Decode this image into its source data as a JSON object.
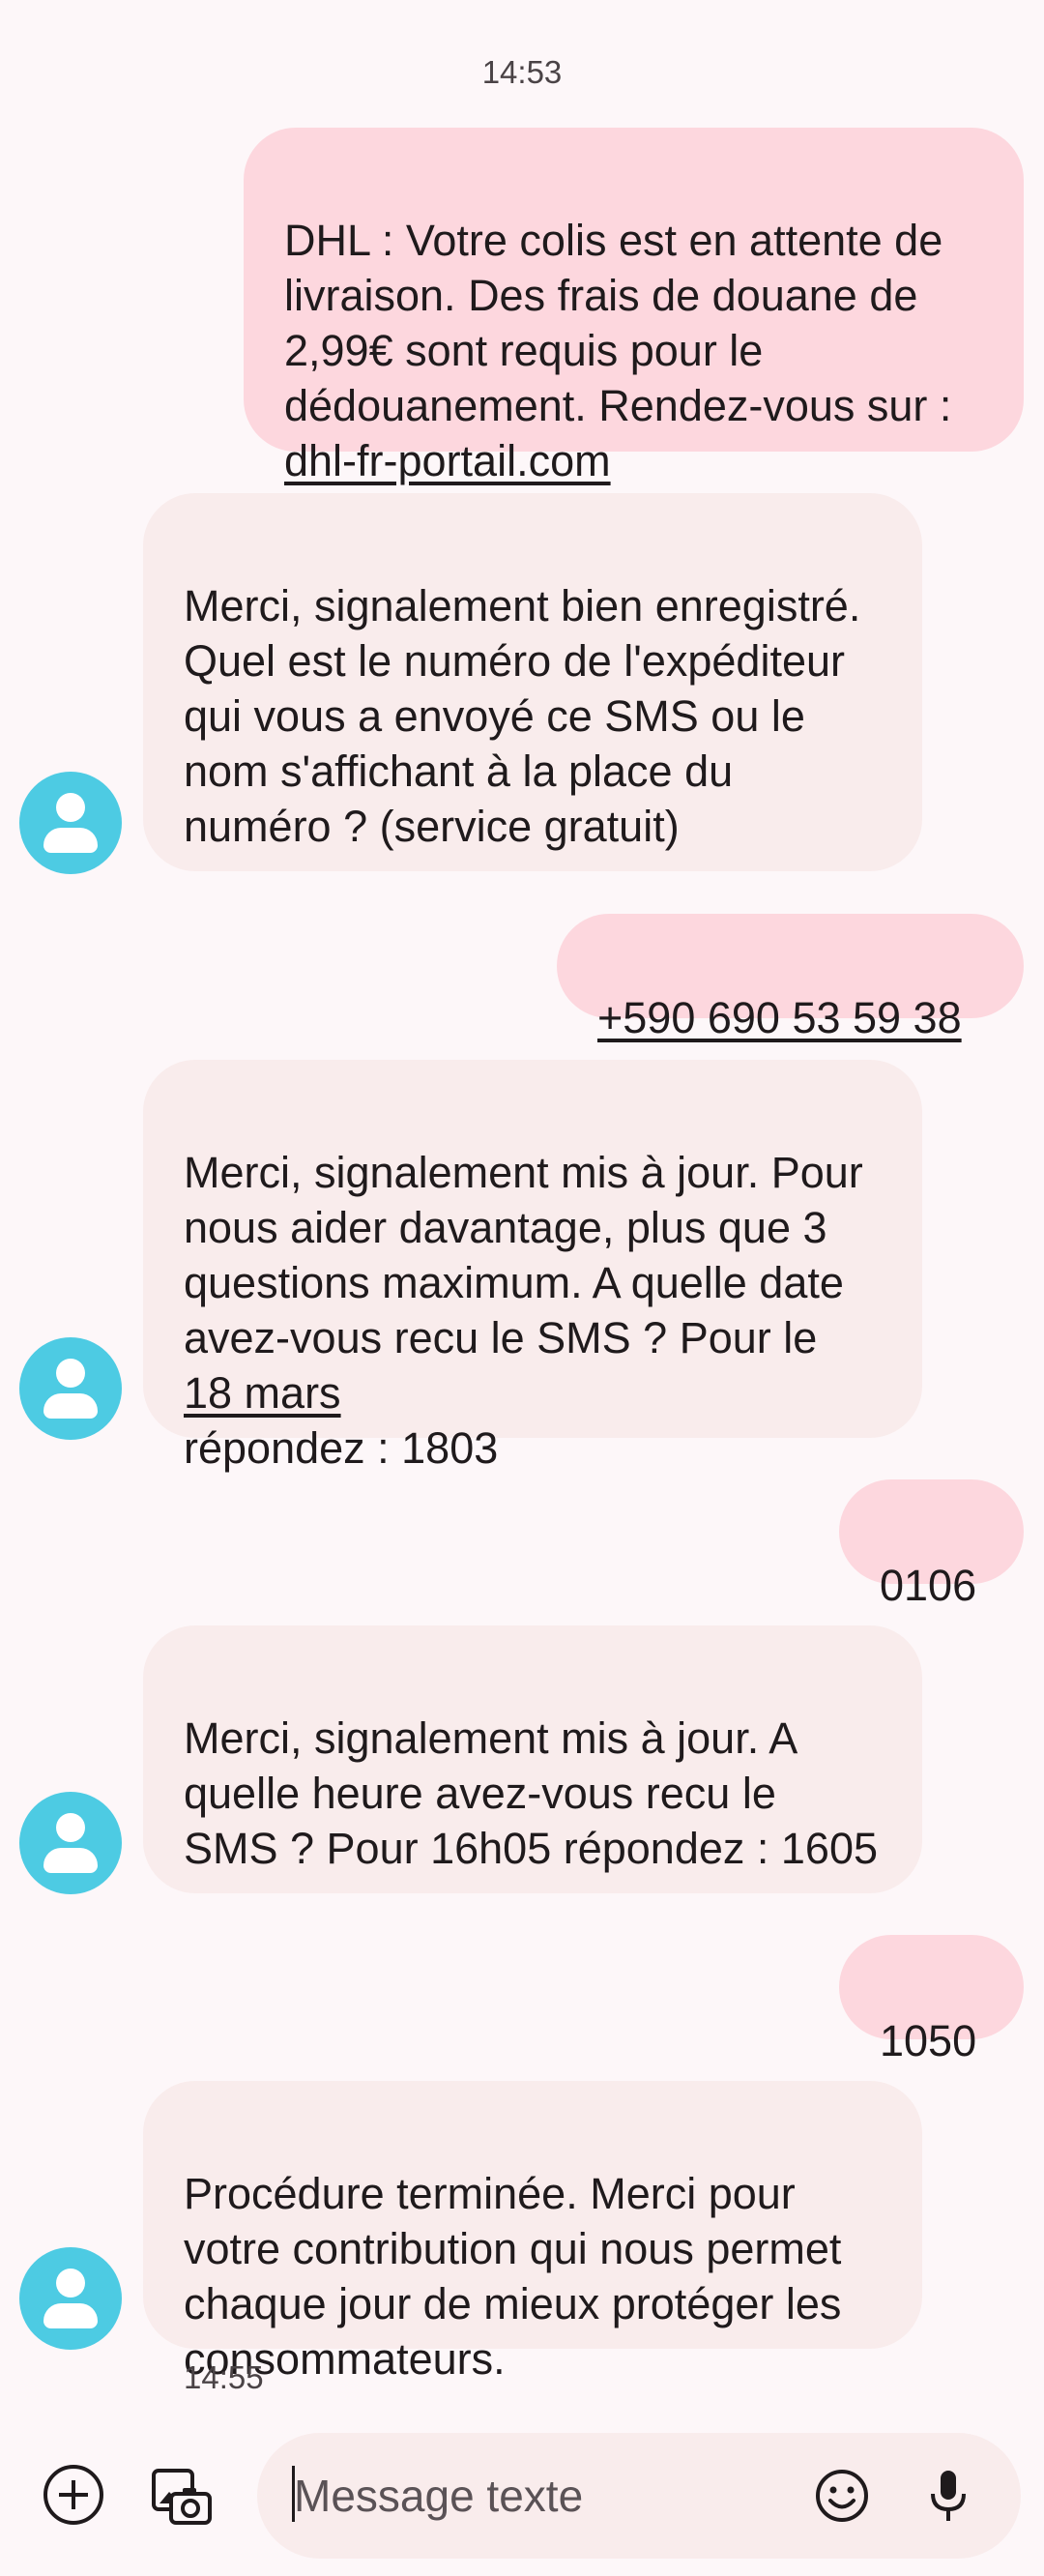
{
  "thread": {
    "timestamp_top": "14:53",
    "timestamp_bottom": "14:55",
    "messages": [
      {
        "from": "me",
        "text": "DHL : Votre colis est en attente de livraison. Des frais de douane de 2,99€ sont requis pour le dédouanement. Rendez-vous sur :",
        "link": "dhl-fr-portail.com"
      },
      {
        "from": "them",
        "text": "Merci, signalement bien enregistré. Quel est le numéro de l'expéditeur qui vous a envoyé ce SMS ou le nom s'affichant à la place du numéro ?  (service gratuit)"
      },
      {
        "from": "me",
        "link": "+590 690 53 59 38"
      },
      {
        "from": "them",
        "text_before": "Merci, signalement mis à jour. Pour nous aider davantage, plus que 3 questions maximum. A quelle date avez-vous recu le SMS ? Pour le",
        "link": "18 mars",
        "text_after": "répondez : 1803"
      },
      {
        "from": "me",
        "text": "0106"
      },
      {
        "from": "them",
        "text": "Merci, signalement mis à jour. A quelle heure avez-vous recu le SMS ? Pour 16h05 répondez : 1605"
      },
      {
        "from": "me",
        "text": "1050"
      },
      {
        "from": "them",
        "text": "Procédure terminée. Merci pour votre contribution qui nous permet chaque jour de mieux protéger les consommateurs."
      }
    ]
  },
  "composer": {
    "placeholder": "Message texte",
    "icons": [
      "add-icon",
      "gallery-icon",
      "emoji-icon",
      "mic-icon"
    ]
  },
  "colors": {
    "background": "#fdf7f9",
    "outgoing_bubble": "#fdd7de",
    "incoming_bubble": "#f9ecec",
    "avatar": "#4dcbe3"
  }
}
